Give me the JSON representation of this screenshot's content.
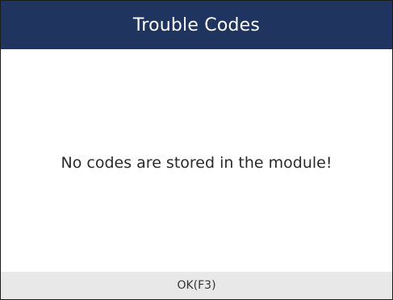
{
  "header": {
    "title": "Trouble Codes"
  },
  "main": {
    "message": "No codes are stored in the module!"
  },
  "footer": {
    "ok_label": "OK(F3)"
  },
  "colors": {
    "header_background": "#1f3560",
    "header_text": "#ffffff",
    "footer_background": "#e8e8e8"
  }
}
